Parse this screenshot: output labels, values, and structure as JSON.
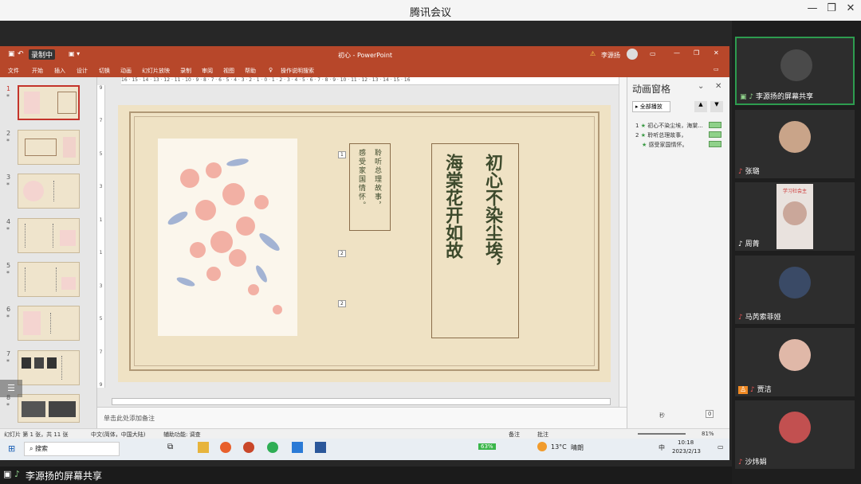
{
  "window": {
    "title": "腾讯会议",
    "minimize": "—",
    "restore": "❐",
    "close": "✕"
  },
  "ppt": {
    "recording_badge": "录制中",
    "doc_title": "初心 - PowerPoint",
    "user_warning": "⚠",
    "user_name": "李源扬",
    "menu": [
      "文件",
      "开始",
      "插入",
      "设计",
      "切换",
      "动画",
      "幻灯片放映",
      "录制",
      "审阅",
      "视图",
      "帮助"
    ],
    "search_label": "操作说明搜索",
    "ruler_h": "16 · 15 · 14 · 13 · 12 · 11 · 10 · 9 · 8 · 7 · 6 · 5 · 4 · 3 · 2 · 1 · 0 · 1 · 2 · 3 · 4 · 5 · 6 · 7 · 8 · 9 · 10 · 11 · 12 · 13 · 14 · 15 · 16",
    "ruler_v": [
      "9",
      "8",
      "7",
      "6",
      "5",
      "4",
      "3",
      "2",
      "1",
      "0",
      "1",
      "2",
      "3",
      "4",
      "5",
      "6",
      "7",
      "8",
      "9"
    ],
    "thumb_numbers": [
      "1",
      "2",
      "3",
      "4",
      "5",
      "6",
      "7",
      "8"
    ],
    "thumb_star": "*",
    "slide": {
      "small_col1": "聆听总理故事，",
      "small_col2": "感受家国情怀。",
      "big_col1": "初心不染尘埃，",
      "big_col2": "海棠花开如故",
      "tag1": "1",
      "tag2": "2",
      "tag3": "2"
    },
    "notes_placeholder": "单击此处添加备注",
    "anim_pane": {
      "title": "动画窗格",
      "play_all": "全部播放",
      "items": [
        {
          "num": "1",
          "label": "初心不染尘埃，海棠..."
        },
        {
          "num": "2",
          "label": "聆听总理故事，"
        },
        {
          "num": "",
          "label": "感受家国情怀。"
        }
      ],
      "seconds": "秒",
      "page_indicator": "0"
    },
    "status": {
      "slide_info": "幻灯片 第 1 张，共 11 张",
      "language": "中文(简体，中国大陆)",
      "accessibility": "辅助功能: 调查",
      "notes": "备注",
      "comments": "批注",
      "zoom": "81%"
    },
    "taskbar": {
      "search": "搜索",
      "battery": "63%",
      "temp": "13°C",
      "weather": "晴朗",
      "ime": "中",
      "time": "10:18",
      "date": "2023/2/13"
    }
  },
  "participants": [
    {
      "name": "李源扬的屏幕共享",
      "active": true,
      "avatar_color": "#4a4a4a"
    },
    {
      "name": "张璐",
      "active": false,
      "avatar_color": "#c9a489"
    },
    {
      "name": "周菁",
      "active": false,
      "avatar_color": "#d9c9c0"
    },
    {
      "name": "马芮索菲娅",
      "active": false,
      "avatar_color": "#3a4a66"
    },
    {
      "name": "贾洁",
      "active": false,
      "avatar_color": "#e0b8a8"
    },
    {
      "name": "沙炜娟",
      "active": false,
      "avatar_color": "#c25050"
    }
  ],
  "participant_video_title": "学习社会主",
  "bottom_bar": {
    "share_label": "李源扬的屏幕共享"
  },
  "colors": {
    "ppt_accent": "#b7472a",
    "active_green": "#2d9c4f",
    "anim_bar": "#8fd18a"
  }
}
